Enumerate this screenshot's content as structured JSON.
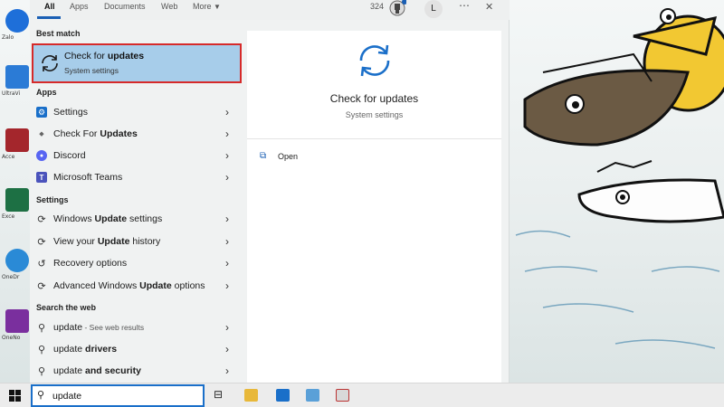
{
  "tabs": [
    {
      "label": "All"
    },
    {
      "label": "Apps"
    },
    {
      "label": "Documents"
    },
    {
      "label": "Web"
    },
    {
      "label": "More"
    }
  ],
  "topbar": {
    "points": "324",
    "avatar": "L",
    "more_icon": "ellipsis-icon",
    "close_icon": "close-icon"
  },
  "best_match": {
    "heading": "Best match",
    "title_pre": "Check for ",
    "title_bold": "updates",
    "subtitle": "System settings"
  },
  "apps": {
    "heading": "Apps",
    "items": [
      {
        "pre": "Settings",
        "bold": "",
        "post": "",
        "icon": "gear-icon"
      },
      {
        "pre": "Check For ",
        "bold": "Updates",
        "post": "",
        "icon": "app-icon"
      },
      {
        "pre": "Discord",
        "bold": "",
        "post": "",
        "icon": "discord-icon"
      },
      {
        "pre": "Microsoft Teams",
        "bold": "",
        "post": "",
        "icon": "teams-icon"
      }
    ]
  },
  "settings": {
    "heading": "Settings",
    "items": [
      {
        "pre": "Windows ",
        "bold": "Update",
        "post": " settings",
        "icon": "refresh-icon"
      },
      {
        "pre": "View your ",
        "bold": "Update",
        "post": " history",
        "icon": "refresh-icon"
      },
      {
        "pre": "Recovery options",
        "bold": "",
        "post": "",
        "icon": "recovery-icon"
      },
      {
        "pre": "Advanced Windows ",
        "bold": "Update",
        "post": " options",
        "icon": "refresh-icon"
      }
    ]
  },
  "web": {
    "heading": "Search the web",
    "items": [
      {
        "pre": "update",
        "bold": "",
        "post": "",
        "suffix": " - See web results",
        "icon": "search-icon"
      },
      {
        "pre": "update ",
        "bold": "drivers",
        "post": "",
        "suffix": "",
        "icon": "search-icon"
      },
      {
        "pre": "update ",
        "bold": "and security",
        "post": "",
        "suffix": "",
        "icon": "search-icon"
      }
    ]
  },
  "detail": {
    "title": "Check for updates",
    "subtitle": "System settings",
    "open_label": "Open"
  },
  "search": {
    "value": "update"
  },
  "desktop": {
    "labels": [
      "Zalo",
      "UltraVi",
      "Acce",
      "Exce",
      "OneDr",
      "OneNo"
    ]
  },
  "colors": {
    "accent": "#1a5fb4",
    "highlight": "#a7cdea",
    "outline": "#d62a2a"
  }
}
